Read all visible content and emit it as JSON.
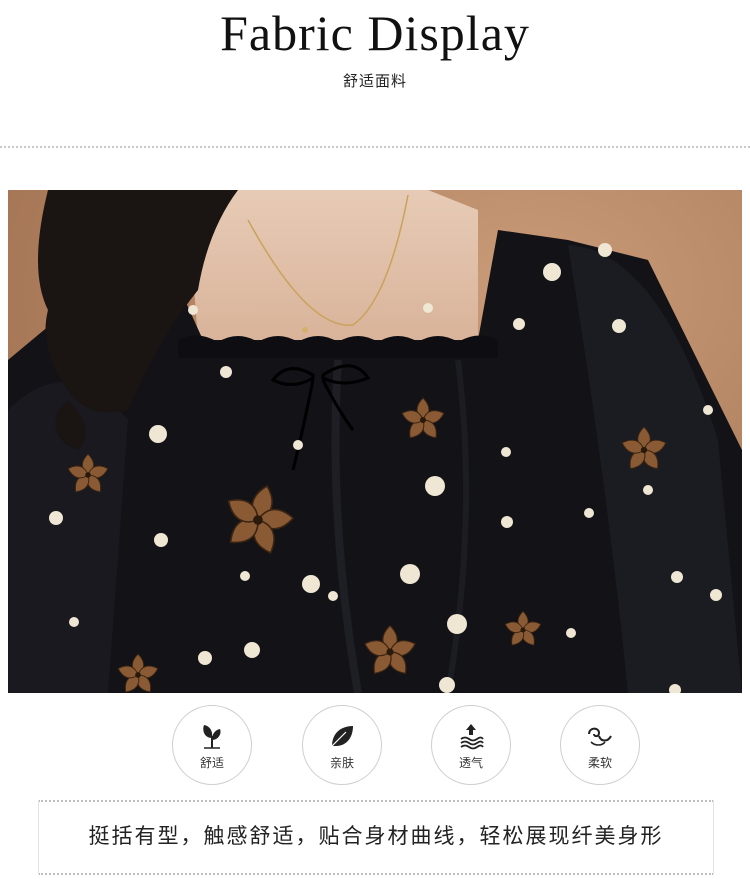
{
  "header": {
    "title": "Fabric  Display",
    "subtitle": "舒适面料"
  },
  "photo": {
    "alt_subject": "black-polka-dot-blouse-closeup",
    "colors": {
      "background": "#b98764",
      "fabric": "#121217",
      "dot": "#efe6d3",
      "flower": "#8a5a34",
      "hair": "#1a1412"
    }
  },
  "features": [
    {
      "label": "舒适",
      "icon": "leaf-sprout-icon"
    },
    {
      "label": "亲肤",
      "icon": "leaf-icon"
    },
    {
      "label": "透气",
      "icon": "airflow-arrow-icon"
    },
    {
      "label": "柔软",
      "icon": "soft-swirl-icon"
    }
  ],
  "description": "挺括有型，触感舒适，贴合身材曲线，轻松展现纤美身形"
}
